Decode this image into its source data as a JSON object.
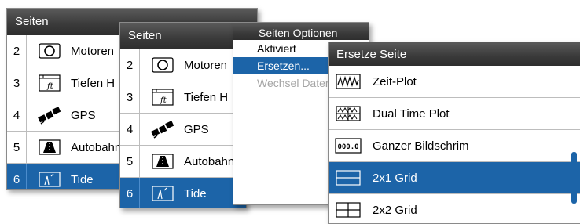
{
  "pages_panel_back": {
    "title": "Seiten",
    "items": [
      {
        "num": "2",
        "label": "Motoren",
        "icon": "gauge-icon"
      },
      {
        "num": "3",
        "label": "Tiefen H",
        "icon": "depth-ft-icon"
      },
      {
        "num": "4",
        "label": "GPS",
        "icon": "satellite-icon"
      },
      {
        "num": "5",
        "label": "Autobahn",
        "icon": "highway-icon"
      },
      {
        "num": "6",
        "label": "Tide",
        "icon": "tide-icon",
        "selected": true
      }
    ]
  },
  "pages_panel_front": {
    "title": "Seiten",
    "items": [
      {
        "num": "2",
        "label": "Motoren",
        "icon": "gauge-icon"
      },
      {
        "num": "3",
        "label": "Tiefen H",
        "icon": "depth-ft-icon"
      },
      {
        "num": "4",
        "label": "GPS",
        "icon": "satellite-icon"
      },
      {
        "num": "5",
        "label": "Autobahn",
        "icon": "highway-icon"
      },
      {
        "num": "6",
        "label": "Tide",
        "icon": "tide-icon",
        "selected": true
      }
    ]
  },
  "options_menu": {
    "title": "Seiten Optionen",
    "items": [
      {
        "label": "Aktiviert"
      },
      {
        "label": "Ersetzen...",
        "selected": true
      },
      {
        "label": "Wechsel Daten",
        "disabled": true
      }
    ]
  },
  "replace_dialog": {
    "title": "Ersetze Seite",
    "items": [
      {
        "label": "Zeit-Plot",
        "icon": "time-plot-icon"
      },
      {
        "label": "Dual Time Plot",
        "icon": "dual-time-plot-icon"
      },
      {
        "label": "Ganzer Bildschrim",
        "icon": "full-screen-digits-icon",
        "icon_text": "000.0"
      },
      {
        "label": "2x1 Grid",
        "icon": "grid-2x1-icon",
        "selected": true
      },
      {
        "label": "2x2 Grid",
        "icon": "grid-2x2-icon"
      }
    ]
  },
  "colors": {
    "selection": "#1c64a8",
    "header": "#3a3a3a"
  }
}
